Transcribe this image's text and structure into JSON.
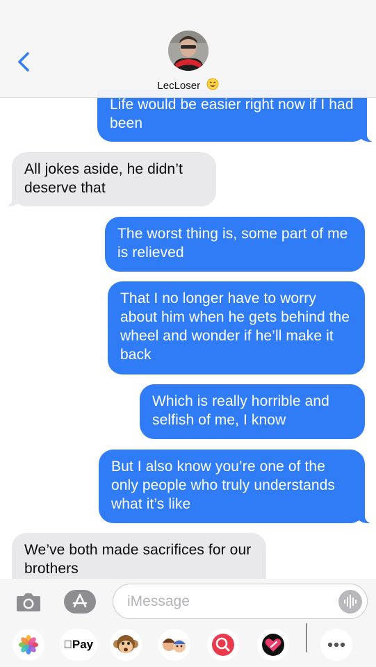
{
  "header": {
    "contact_name": "LecLoser",
    "contact_emoji": "smiling-face-emoji"
  },
  "messages": [
    {
      "direction": "outgoing",
      "text": "Life would be easier right now if I had been"
    },
    {
      "direction": "incoming",
      "text": "All jokes aside, he didn’t deserve that"
    },
    {
      "direction": "outgoing",
      "text": "The worst thing is, some part of me is relieved"
    },
    {
      "direction": "outgoing",
      "text": "That I no longer have to worry about him when he gets behind the wheel and wonder if he’ll make it back"
    },
    {
      "direction": "outgoing",
      "text": "Which is really horrible and selfish of me, I know"
    },
    {
      "direction": "outgoing",
      "text": "But I also know you’re one of the only people who truly understands what it’s like"
    },
    {
      "direction": "incoming",
      "text": "We’ve both made sacrifices for our brothers"
    }
  ],
  "composer": {
    "placeholder": "iMessage",
    "value": ""
  },
  "app_drawer": {
    "items": [
      {
        "icon": "photos-icon"
      },
      {
        "icon": "apple-pay-icon",
        "label": "Pay"
      },
      {
        "icon": "monkey-animoji-icon"
      },
      {
        "icon": "memoji-stickers-icon"
      },
      {
        "icon": "image-search-icon"
      },
      {
        "icon": "digital-touch-icon"
      },
      {
        "icon": "more-apps-icon"
      }
    ]
  },
  "colors": {
    "outgoing_bubble": "#2f7cf6",
    "incoming_bubble": "#e9e9eb",
    "accent": "#2f7cf6"
  }
}
